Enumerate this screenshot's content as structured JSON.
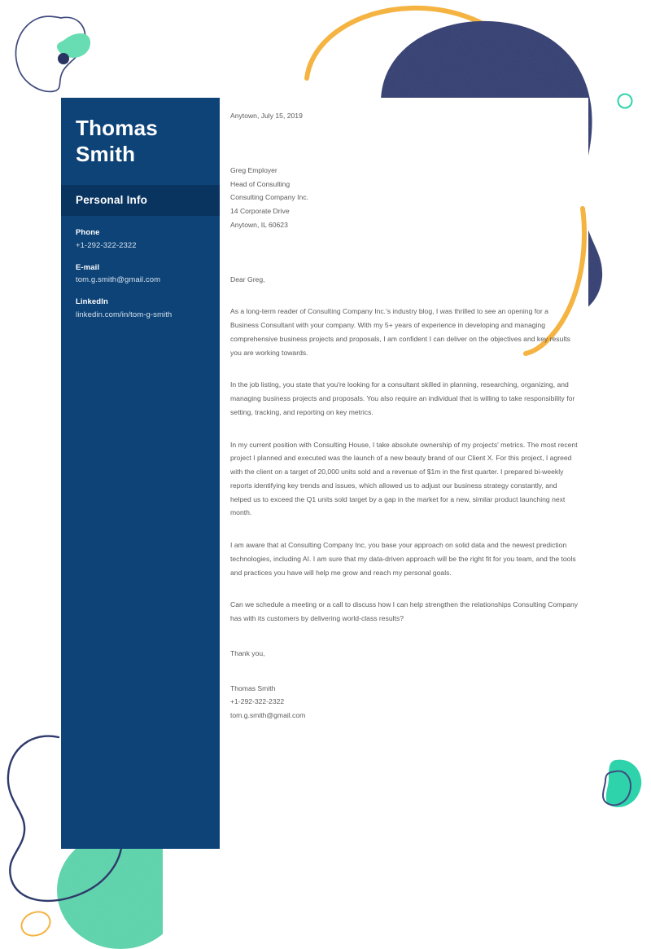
{
  "document": {
    "type": "cover-letter",
    "colors": {
      "sidebar_navy": "#0d4377",
      "sidebar_band_navy": "#0a3460",
      "blob_navy": "#3f4a7e",
      "mint": "#4fd9b0",
      "orange": "#f5b342",
      "body_text": "#5a5a5a",
      "page_white": "#ffffff"
    }
  },
  "sidebar": {
    "name": {
      "first": "Thomas",
      "last": "Smith"
    },
    "section_title": "Personal Info",
    "contacts": [
      {
        "label": "Phone",
        "value": "+1-292-322-2322"
      },
      {
        "label": "E-mail",
        "value": "tom.g.smith@gmail.com"
      },
      {
        "label": "LinkedIn",
        "value": "linkedin.com/in/tom-g-smith"
      }
    ]
  },
  "letter": {
    "date": "Anytown, July 15, 2019",
    "recipient": [
      "Greg Employer",
      "Head of Consulting",
      "Consulting Company Inc.",
      "14 Corporate Drive",
      "Anytown, IL 60623"
    ],
    "salutation": "Dear Greg,",
    "paragraphs": [
      "As a long-term reader of Consulting Company Inc.'s industry blog, I was thrilled to see an opening for a Business Consultant with your company. With my 5+ years of experience in developing and managing comprehensive business projects and proposals, I am confident I can deliver on the objectives and key results you are working towards.",
      "In the job listing, you state that you're looking for a consultant skilled in planning, researching, organizing, and managing business projects and proposals. You also require an individual that is willing to take responsibility for setting, tracking, and reporting on key metrics.",
      "In my current position with Consulting House, I take absolute ownership of my projects' metrics. The most recent project I planned and executed was the launch of a new beauty brand of our Client X. For this project, I agreed with the client on a target of 20,000 units sold and a revenue of $1m in the first quarter. I prepared bi-weekly reports identifying key trends and issues, which allowed us to adjust our business strategy constantly, and helped us to exceed the Q1 units sold target by a gap in the market for a new, similar product launching next month.",
      "I am aware that at Consulting Company Inc, you base your approach on solid data and the newest prediction technologies, including AI. I am sure that my data-driven approach will be the right fit for you team, and the tools and practices you have will help me grow and reach my personal goals.",
      "Can we schedule a meeting or a call to discuss how I can help strengthen the relationships Consulting Company has with its customers by delivering world-class results?"
    ],
    "closing": "Thank you,",
    "signature": [
      "Thomas Smith",
      "+1-292-322-2322",
      "tom.g.smith@gmail.com"
    ]
  },
  "decorations": [
    {
      "name": "navy-outline-comma-top-left",
      "shape": "outlined-blob",
      "color": "#3f4a7e"
    },
    {
      "name": "mint-blob-top-left",
      "shape": "filled-blob",
      "color": "#4fd9b0"
    },
    {
      "name": "navy-dot-top-left",
      "shape": "dot",
      "color": "#2a3463"
    },
    {
      "name": "orange-arc-top",
      "shape": "open-arc",
      "color": "#f5b342"
    },
    {
      "name": "navy-textured-blob-top-right",
      "shape": "filled-blob",
      "color": "#3f4a7e"
    },
    {
      "name": "teal-ring-top-right",
      "shape": "ring",
      "color": "#2ed3ac"
    },
    {
      "name": "navy-outline-peanut-bottom-left",
      "shape": "outlined-blob",
      "color": "#2f3a6b"
    },
    {
      "name": "mint-circle-bottom-left",
      "shape": "circle",
      "color": "#4fd9b0"
    },
    {
      "name": "orange-ring-bottom-left",
      "shape": "ring",
      "color": "#f5b342"
    },
    {
      "name": "mint-blob-bottom-right",
      "shape": "filled-blob",
      "color": "#2ed3ac"
    },
    {
      "name": "navy-outline-blob-bottom-right",
      "shape": "outlined-blob",
      "color": "#3f4a7e"
    },
    {
      "name": "navy-outline-peanut-bottom-right",
      "shape": "outlined-blob",
      "color": "#3f4a7e"
    },
    {
      "name": "orange-dot-bottom-right",
      "shape": "dot",
      "color": "#f5b342"
    }
  ]
}
